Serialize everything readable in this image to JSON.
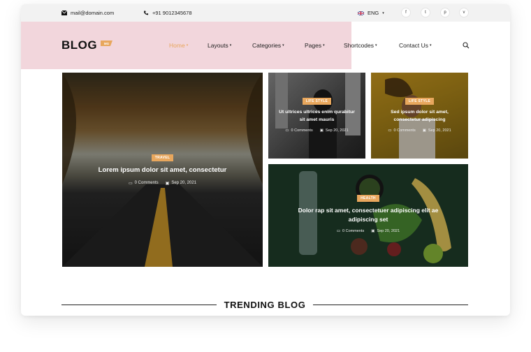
{
  "topbar": {
    "email": "mail@domain.com",
    "phone": "+91 9012345678",
    "language": "ENG",
    "socials": [
      "f",
      "t",
      "p",
      "v"
    ]
  },
  "header": {
    "logo": "BLOG",
    "logo_tag": "MG",
    "nav": [
      {
        "label": "Home",
        "active": true
      },
      {
        "label": "Layouts",
        "active": false
      },
      {
        "label": "Categories",
        "active": false
      },
      {
        "label": "Pages",
        "active": false
      },
      {
        "label": "Shortcodes",
        "active": false
      },
      {
        "label": "Contact Us",
        "active": false
      }
    ]
  },
  "posts": [
    {
      "category": "TRAVEL",
      "title_lines": [
        "Lorem ipsum dolor sit amet, consectetur"
      ],
      "comments": "0 Comments",
      "date": "Sep 20, 2021"
    },
    {
      "category": "LIFE STYLE",
      "title_lines": [
        "Ut ultrices ultrices enim qurabitur",
        "sit amet mauris"
      ],
      "comments": "0 Comments",
      "date": "Sep 20, 2021"
    },
    {
      "category": "LIFE STYLE",
      "title_lines": [
        "Sed ipsum dolor sit amet,",
        "consectetur adipiscing"
      ],
      "comments": "0 Comments",
      "date": "Sep 20, 2021"
    },
    {
      "category": "HEALTH",
      "title_lines": [
        "Dolor rap sit amet, consectetuer adipiscing elit ae",
        "adipiscing set"
      ],
      "comments": "0 Comments",
      "date": "Sep 20, 2021"
    }
  ],
  "section": {
    "trending_title": "TRENDING BLOG"
  },
  "colors": {
    "accent": "#e8a75d",
    "pink_band": "#f2d6dc",
    "topbar_bg": "#f2f2f2"
  }
}
